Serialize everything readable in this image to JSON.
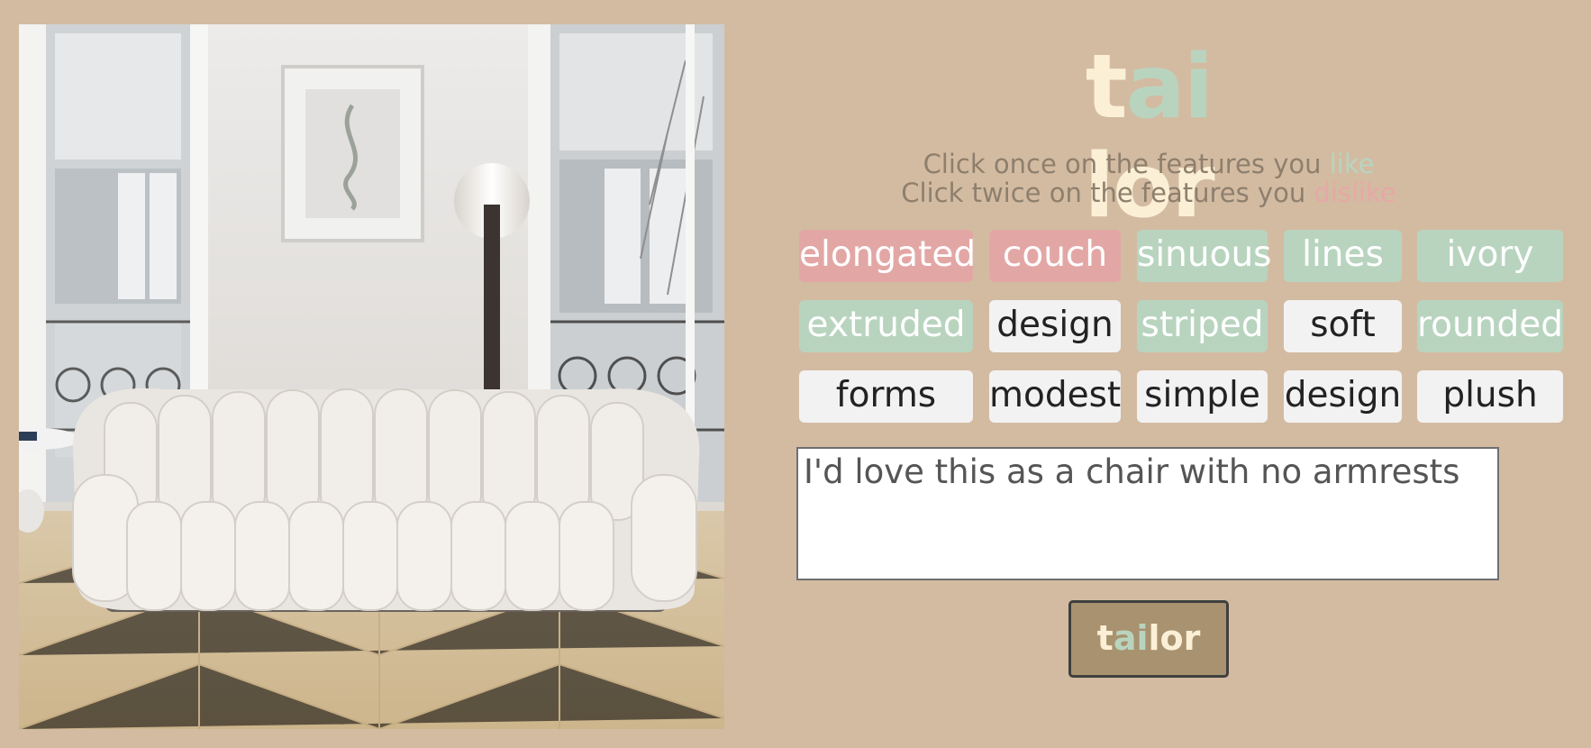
{
  "logo": {
    "parts": [
      {
        "text": "t",
        "color": "#fbf0d6"
      },
      {
        "text": "ai",
        "color": "#b8d4bf"
      },
      {
        "text": "lor",
        "color": "#fbf0d6"
      }
    ]
  },
  "instructions": {
    "line1_prefix": "Click once on the features you ",
    "line1_word": "like",
    "line1_word_color": "#b8d4bf",
    "line2_prefix": "Click twice on the features you ",
    "line2_word": "dislike",
    "line2_word_color": "#e6a8a7"
  },
  "features": [
    {
      "label": "elongated",
      "state": "dislike"
    },
    {
      "label": "couch",
      "state": "dislike"
    },
    {
      "label": "sinuous",
      "state": "like"
    },
    {
      "label": "lines",
      "state": "like"
    },
    {
      "label": "ivory",
      "state": "like"
    },
    {
      "label": "extruded",
      "state": "like"
    },
    {
      "label": "design",
      "state": "neutral"
    },
    {
      "label": "striped",
      "state": "like"
    },
    {
      "label": "soft",
      "state": "neutral"
    },
    {
      "label": "rounded",
      "state": "like"
    },
    {
      "label": "forms",
      "state": "neutral"
    },
    {
      "label": "modest",
      "state": "neutral"
    },
    {
      "label": "simple",
      "state": "neutral"
    },
    {
      "label": "design",
      "state": "neutral"
    },
    {
      "label": "plush",
      "state": "neutral"
    }
  ],
  "note": {
    "value": "I'd love this as a chair with no armrests"
  },
  "submit_button": {
    "parts": [
      {
        "text": "t",
        "color": "#fbf0d6"
      },
      {
        "text": "ai",
        "color": "#b8d4bf"
      },
      {
        "text": "lor",
        "color": "#fbf0d6"
      }
    ]
  },
  "colors": {
    "background": "#d3bba2",
    "like": "#b8d4bf",
    "dislike": "#e2a7a5",
    "neutral": "#f3f2f2"
  }
}
